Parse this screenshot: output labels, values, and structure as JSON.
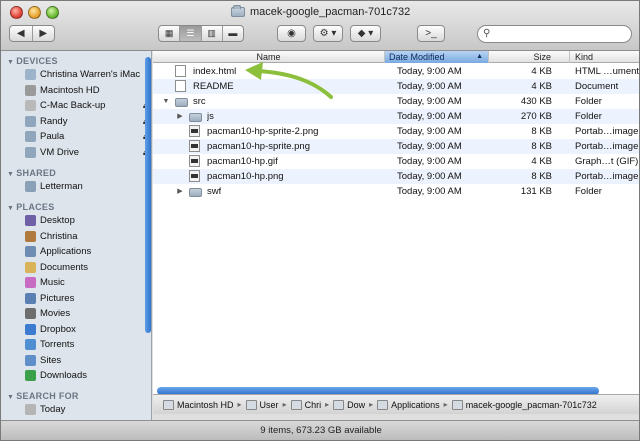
{
  "window": {
    "title": "macek-google_pacman-701c732",
    "status": "9 items, 673.23 GB available"
  },
  "toolbar": {
    "back_label": "◀",
    "forward_label": "▶",
    "view_icons_label": "▦",
    "view_list_label": "☰",
    "view_columns_label": "▥",
    "view_coverflow_label": "▬",
    "quicklook_label": "◉",
    "action_label": "⚙ ▾",
    "dropbox_label": "◆ ▾",
    "terminal_label": ">_",
    "search_placeholder": ""
  },
  "sidebar": {
    "devices_header": "DEVICES",
    "devices": [
      {
        "label": "Christina Warren's iMac",
        "icon": "imac-icon"
      },
      {
        "label": "Macintosh HD",
        "icon": "hard-drive-icon"
      },
      {
        "label": "C-Mac Back-up",
        "icon": "external-drive-icon",
        "eject": "⏏"
      },
      {
        "label": "Randy",
        "icon": "network-drive-icon",
        "eject": "⏏"
      },
      {
        "label": "Paula",
        "icon": "network-drive-icon",
        "eject": "⏏"
      },
      {
        "label": "VM Drive",
        "icon": "network-drive-icon",
        "eject": "⏏"
      }
    ],
    "shared_header": "SHARED",
    "shared": [
      {
        "label": "Letterman",
        "icon": "monitor-icon"
      }
    ],
    "places_header": "PLACES",
    "places": [
      {
        "label": "Desktop",
        "icon": "desktop-icon"
      },
      {
        "label": "Christina",
        "icon": "home-icon"
      },
      {
        "label": "Applications",
        "icon": "applications-icon"
      },
      {
        "label": "Documents",
        "icon": "documents-icon"
      },
      {
        "label": "Music",
        "icon": "music-icon"
      },
      {
        "label": "Pictures",
        "icon": "pictures-icon"
      },
      {
        "label": "Movies",
        "icon": "movies-icon"
      },
      {
        "label": "Dropbox",
        "icon": "dropbox-icon"
      },
      {
        "label": "Torrents",
        "icon": "torrents-icon"
      },
      {
        "label": "Sites",
        "icon": "sites-icon"
      },
      {
        "label": "Downloads",
        "icon": "downloads-icon"
      }
    ],
    "search_header": "SEARCH FOR",
    "search_for": [
      {
        "label": "Today",
        "icon": "clock-icon"
      }
    ]
  },
  "columns": {
    "name": "Name",
    "date": "Date Modified",
    "size": "Size",
    "kind": "Kind"
  },
  "files": [
    {
      "name": "index.html",
      "date": "Today, 9:00 AM",
      "size": "4 KB",
      "kind": "HTML …ument",
      "icon": "document-icon",
      "indent": 0,
      "disclosure": ""
    },
    {
      "name": "README",
      "date": "Today, 9:00 AM",
      "size": "4 KB",
      "kind": "Document",
      "icon": "document-icon",
      "indent": 0,
      "disclosure": ""
    },
    {
      "name": "src",
      "date": "Today, 9:00 AM",
      "size": "430 KB",
      "kind": "Folder",
      "icon": "folder-icon",
      "indent": 0,
      "disclosure": "▼"
    },
    {
      "name": "js",
      "date": "Today, 9:00 AM",
      "size": "270 KB",
      "kind": "Folder",
      "icon": "folder-icon",
      "indent": 1,
      "disclosure": "▶"
    },
    {
      "name": "pacman10-hp-sprite-2.png",
      "date": "Today, 9:00 AM",
      "size": "8 KB",
      "kind": "Portab…image",
      "icon": "image-icon",
      "indent": 1,
      "disclosure": ""
    },
    {
      "name": "pacman10-hp-sprite.png",
      "date": "Today, 9:00 AM",
      "size": "8 KB",
      "kind": "Portab…image",
      "icon": "image-icon",
      "indent": 1,
      "disclosure": ""
    },
    {
      "name": "pacman10-hp.gif",
      "date": "Today, 9:00 AM",
      "size": "4 KB",
      "kind": "Graph…t (GIF)",
      "icon": "image-icon",
      "indent": 1,
      "disclosure": ""
    },
    {
      "name": "pacman10-hp.png",
      "date": "Today, 9:00 AM",
      "size": "8 KB",
      "kind": "Portab…image",
      "icon": "image-icon",
      "indent": 1,
      "disclosure": ""
    },
    {
      "name": "swf",
      "date": "Today, 9:00 AM",
      "size": "131 KB",
      "kind": "Folder",
      "icon": "folder-icon",
      "indent": 1,
      "disclosure": "▶"
    }
  ],
  "pathbar": [
    {
      "label": "Macintosh HD",
      "icon": "hard-drive-icon"
    },
    {
      "label": "User",
      "icon": "users-folder-icon"
    },
    {
      "label": "Chri",
      "icon": "home-icon"
    },
    {
      "label": "Dow",
      "icon": "downloads-icon"
    },
    {
      "label": "Applications",
      "icon": "applications-icon"
    },
    {
      "label": "macek-google_pacman-701c732",
      "icon": "folder-icon"
    }
  ],
  "colors": {
    "accent": "#2f73cf",
    "sidebar_bg": "#dde4ec",
    "arrow": "#8cbf3b",
    "row_alt": "#edf3fe"
  }
}
